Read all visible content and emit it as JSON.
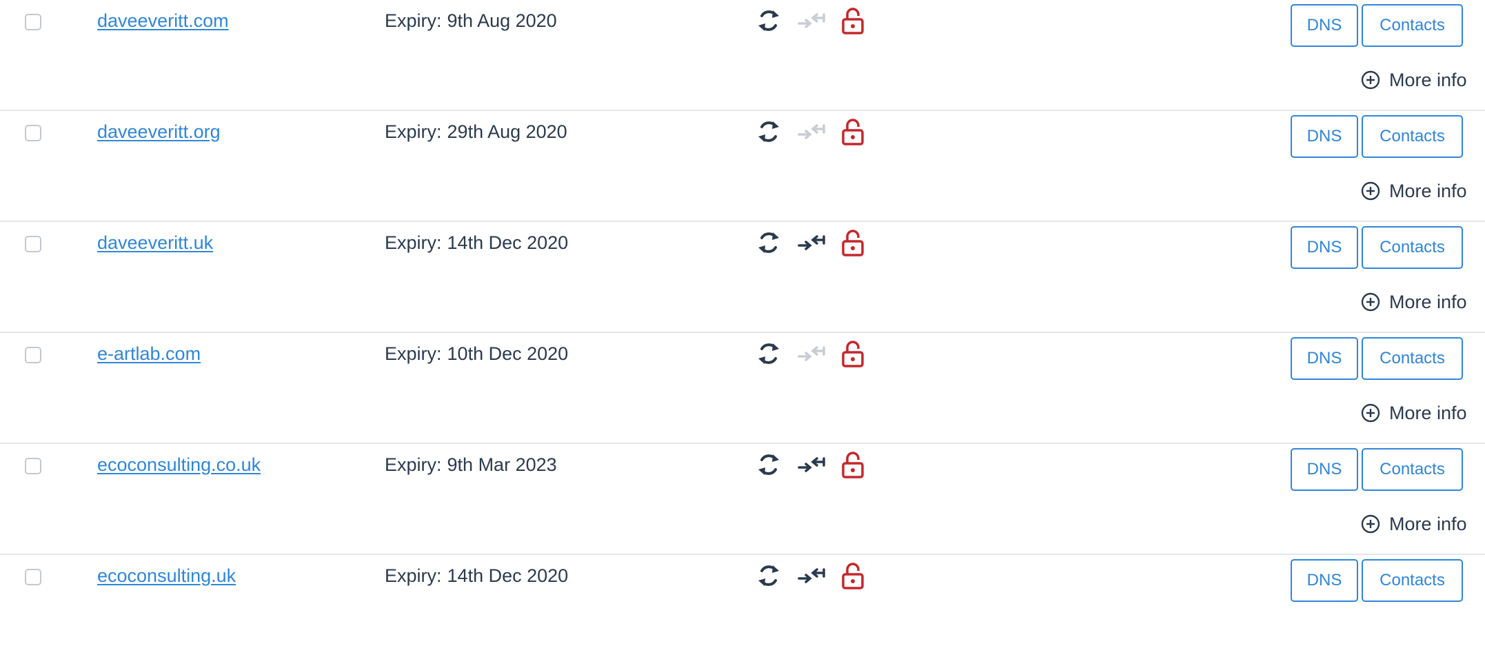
{
  "colors": {
    "link": "#2f86d9",
    "text": "#2a3a4e",
    "icon_active": "#2a3a4e",
    "icon_inactive": "#c9cdd3",
    "lock": "#c4272c",
    "divider": "#e3e6ea"
  },
  "labels": {
    "expiry_prefix": "Expiry:",
    "dns_button": "DNS",
    "contacts_button": "Contacts",
    "more_info": "More info"
  },
  "icons": {
    "renew": "refresh-icon",
    "transfer": "transfer-arrows-icon",
    "lock": "padlock-icon",
    "more_info": "plus-circle-icon"
  },
  "domains": [
    {
      "name": "daveeveritt.com",
      "expiry": "9th Aug 2020",
      "transfer_active": false,
      "show_more_info": true
    },
    {
      "name": "daveeveritt.org",
      "expiry": "29th Aug 2020",
      "transfer_active": false,
      "show_more_info": true
    },
    {
      "name": "daveeveritt.uk",
      "expiry": "14th Dec 2020",
      "transfer_active": true,
      "show_more_info": true
    },
    {
      "name": "e-artlab.com",
      "expiry": "10th Dec 2020",
      "transfer_active": false,
      "show_more_info": true
    },
    {
      "name": "ecoconsulting.co.uk",
      "expiry": "9th Mar 2023",
      "transfer_active": true,
      "show_more_info": true
    },
    {
      "name": "ecoconsulting.uk",
      "expiry": "14th Dec 2020",
      "transfer_active": true,
      "show_more_info": false
    }
  ]
}
